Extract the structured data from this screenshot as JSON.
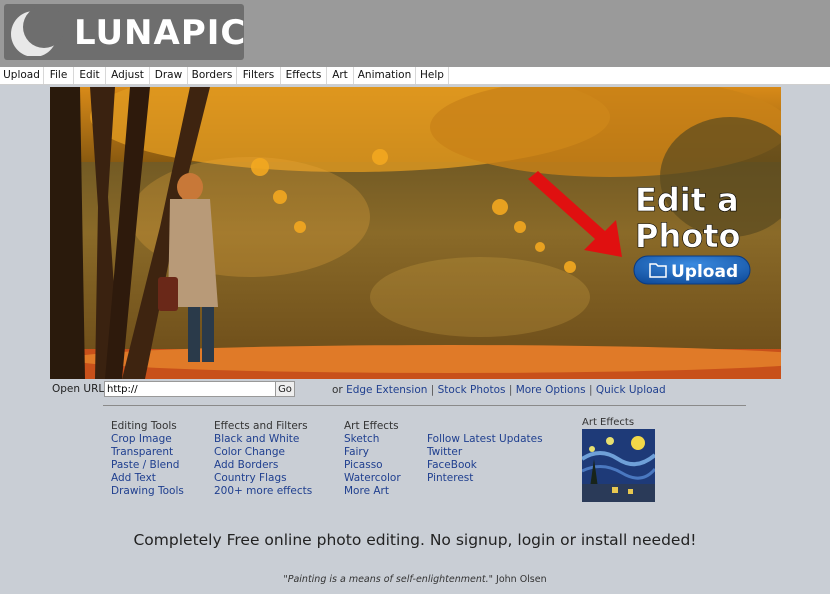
{
  "header": {
    "logo_text": "LUNAPIC"
  },
  "menu": [
    "Upload",
    "File",
    "Edit",
    "Adjust",
    "Draw",
    "Borders",
    "Filters",
    "Effects",
    "Art",
    "Animation",
    "Help"
  ],
  "hero": {
    "title_line1": "Edit a",
    "title_line2": "Photo",
    "upload_label": "Upload"
  },
  "url_bar": {
    "label": "Open URL:",
    "value": "http://",
    "go_label": "Go",
    "prefix": "or",
    "links": [
      "Edge Extension",
      "Stock Photos",
      "More Options",
      "Quick Upload"
    ],
    "separator": "|"
  },
  "columns": [
    {
      "heading": "Editing Tools",
      "links": [
        "Crop Image",
        "Transparent",
        "Paste / Blend",
        "Add Text",
        "Drawing Tools"
      ]
    },
    {
      "heading": "Effects and Filters",
      "links": [
        "Black and White",
        "Color Change",
        "Add Borders",
        "Country Flags",
        "200+ more effects"
      ]
    },
    {
      "heading": "Art Effects",
      "links": [
        "Sketch",
        "Fairy",
        "Picasso",
        "Watercolor",
        "More Art"
      ]
    },
    {
      "heading": "",
      "links": [
        "Follow Latest Updates",
        "Twitter",
        "FaceBook",
        "Pinterest"
      ]
    }
  ],
  "art_effects": {
    "label": "Art Effects"
  },
  "tagline": "Completely Free online photo editing. No signup, login or install needed!",
  "quote": {
    "text": "\"Painting is a means of self-enlightenment.\"",
    "author": "John Olsen"
  },
  "colors": {
    "link": "#1f3f8f",
    "upload_button": "#1a5fb4",
    "arrow": "#e01010",
    "background": "#c9ced5"
  }
}
